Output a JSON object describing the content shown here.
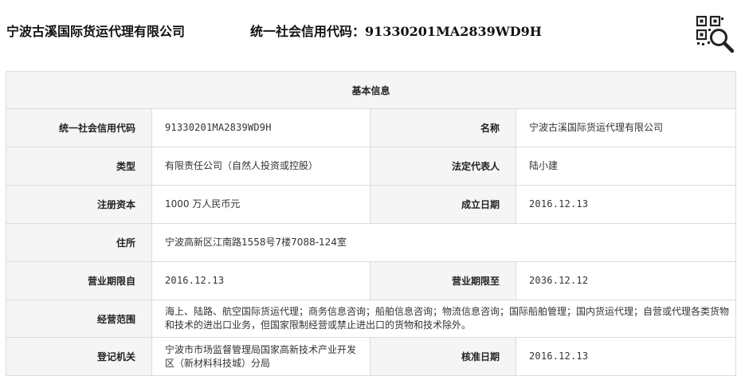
{
  "header": {
    "company_name": "宁波古溪国际货运代理有限公司",
    "credit_code_text": "统一社会信用代码：91330201MA2839WD9H",
    "qr_icon": "qr-search-icon"
  },
  "table": {
    "title": "基本信息",
    "rows": [
      {
        "label_left": "统一社会信用代码",
        "value_left": "91330201MA2839WD9H",
        "label_right": "名称",
        "value_right": "宁波古溪国际货运代理有限公司"
      },
      {
        "label_left": "类型",
        "value_left": "有限责任公司（自然人投资或控股）",
        "label_right": "法定代表人",
        "value_right": "陆小建"
      },
      {
        "label_left": "注册资本",
        "value_left": "1000 万人民币元",
        "label_right": "成立日期",
        "value_right": "2016.12.13"
      },
      {
        "label_left": "住所",
        "value_left": "宁波高新区江南路1558号7楼7088-124室"
      },
      {
        "label_left": "营业期限自",
        "value_left": "2016.12.13",
        "label_right": "营业期限至",
        "value_right": "2036.12.12"
      },
      {
        "label_left": "经营范围",
        "value_left": "海上、陆路、航空国际货运代理；商务信息咨询；船舶信息咨询；物流信息咨询；国际船舶管理；国内货运代理；自营或代理各类货物和技术的进出口业务，但国家限制经营或禁止进出口的货物和技术除外。"
      },
      {
        "label_left": "登记机关",
        "value_left": "宁波市市场监督管理局国家高新技术产业开发区（新材料科技城）分局",
        "label_right": "核准日期",
        "value_right": "2016.12.13"
      }
    ]
  }
}
